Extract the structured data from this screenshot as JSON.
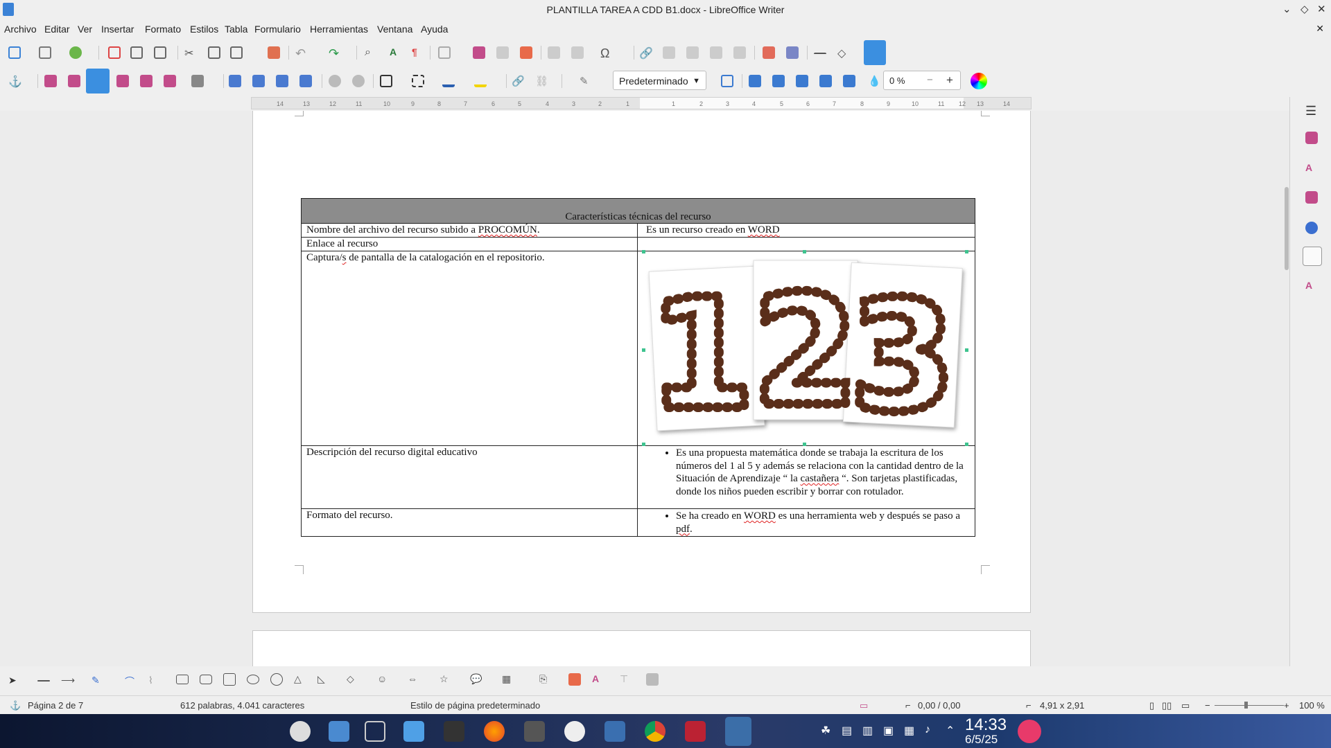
{
  "window": {
    "title": "PLANTILLA TAREA A CDD B1.docx - LibreOffice Writer"
  },
  "menu": [
    "Archivo",
    "Editar",
    "Ver",
    "Insertar",
    "Formato",
    "Estilos",
    "Tabla",
    "Formulario",
    "Herramientas",
    "Ventana",
    "Ayuda"
  ],
  "toolbar": {
    "paragraph_style": "Predeterminado",
    "transparency_value": "0 %"
  },
  "ruler": {
    "left_ticks": [
      "14",
      "13",
      "12",
      "11",
      "10",
      "9",
      "8",
      "7",
      "6",
      "5",
      "4",
      "3",
      "2",
      "1"
    ],
    "right_ticks": [
      "1",
      "2",
      "3",
      "4",
      "5",
      "6",
      "7",
      "8",
      "9",
      "10",
      "11",
      "12",
      "13",
      "14"
    ]
  },
  "table": {
    "header": "Características técnicas del recurso",
    "row1": {
      "label_pre": "Nombre del archivo del recurso subido a ",
      "label_misspelled": "PROCOMÚN",
      "label_post": ".",
      "value_pre": "Es un recurso creado en ",
      "value_misspelled": "WORD"
    },
    "row2": {
      "label": "Enlace al recurso"
    },
    "row3": {
      "label_pre": "Captura/",
      "label_misspelled": "s",
      "label_post": " de pantalla de la catalogación en el repositorio."
    },
    "row4": {
      "label": "Descripción del recurso digital educativo",
      "bullet_pre": "Es una propuesta matemática donde se trabaja la escritura de los números del 1 al 5 y además se relaciona con la cantidad dentro de la Situación de Aprendizaje “ la ",
      "bullet_misspelled": "castañera",
      "bullet_post": " “. Son tarjetas plastificadas, donde los niños pueden escribir y borrar con rotulador."
    },
    "row5": {
      "label": "Formato del recurso.",
      "bullet_pre": "Se ha creado en ",
      "bullet_misspelled1": "WORD",
      "bullet_mid": " es una herramienta web y después se paso a ",
      "bullet_misspelled2": "pdf",
      "bullet_post": "."
    }
  },
  "image": {
    "digits": [
      "1",
      "2",
      "3"
    ],
    "digit_color": "#5a2e1a"
  },
  "status": {
    "page": "Página 2 de 7",
    "words": "612 palabras, 4.041 caracteres",
    "page_style": "Estilo de página predeterminado",
    "position": "0,00 / 0,00",
    "size": "4,91 x 2,91",
    "zoom": "100 %"
  },
  "taskbar": {
    "time": "14:33",
    "date": "6/5/25"
  },
  "colors": {
    "accent": "#3b82d6",
    "selection_handle": "#3ec38f",
    "table_header": "#8c8c8c"
  }
}
